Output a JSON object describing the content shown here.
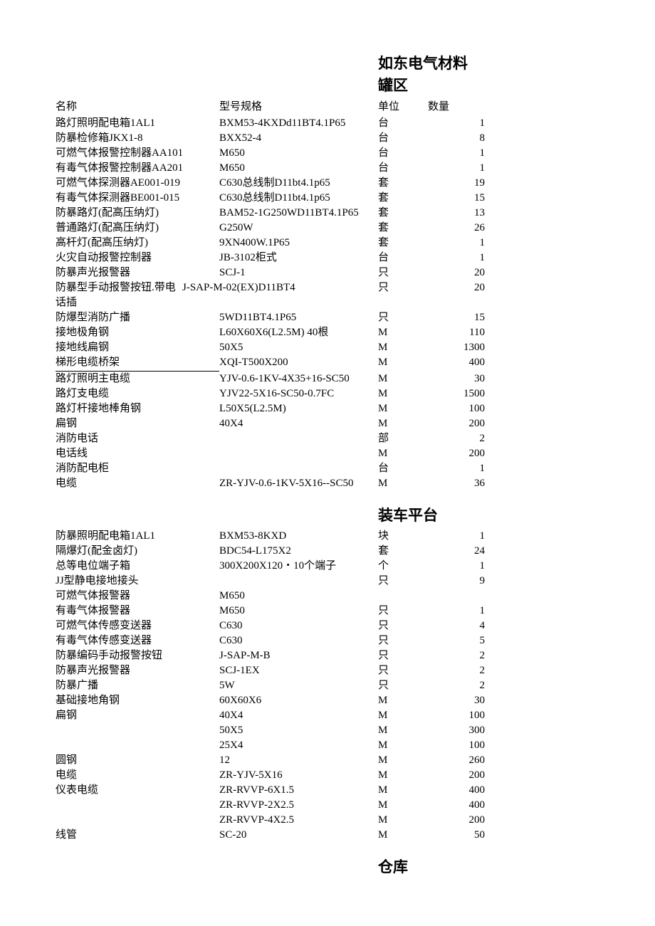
{
  "doc_title": "如东电气材料",
  "section1_title": "罐区",
  "section2_title": "装车平台",
  "section3_title": "仓库",
  "headers": {
    "name": "名称",
    "spec": "型号规格",
    "unit": "单位",
    "qty": "数量"
  },
  "section1_rows": [
    {
      "name": "路灯照明配电箱1AL1",
      "spec": "BXM53-4KXDd11BT4.1P65",
      "unit": "台",
      "qty": "1"
    },
    {
      "name": "防暴检修箱JKX1-8",
      "spec": "BXX52-4",
      "unit": "台",
      "qty": "8"
    },
    {
      "name": "可燃气体报警控制器AA101",
      "spec": "M650",
      "unit": "台",
      "qty": "1"
    },
    {
      "name": "有毒气体报警控制器AA201",
      "spec": "M650",
      "unit": "台",
      "qty": "1"
    },
    {
      "name": "可燃气体探测器AE001-019",
      "spec": "C630总线制D11bt4.1p65",
      "unit": "套",
      "qty": "19"
    },
    {
      "name": "有毒气体探测器BE001-015",
      "spec": "C630总线制D11bt4.1p65",
      "unit": "套",
      "qty": "15"
    },
    {
      "name": "防暴路灯(配高压纳灯)",
      "spec": "BAM52-1G250WD11BT4.1P65",
      "unit": "套",
      "qty": "13"
    },
    {
      "name": "普通路灯(配高压纳灯)",
      "spec": "G250W",
      "unit": "套",
      "qty": "26"
    },
    {
      "name": "高杆灯(配高压纳灯)",
      "spec": "9XN400W.1P65",
      "unit": "套",
      "qty": "1"
    },
    {
      "name": "火灾自动报警控制器",
      "spec": "JB-3102柜式",
      "unit": "台",
      "qty": "1"
    },
    {
      "name": "防暴声光报警器",
      "spec": "SCJ-1",
      "unit": "只",
      "qty": "20"
    },
    {
      "name": "防暴型手动报警按钮.带电话插",
      "spec": "J-SAP-M-02(EX)D11BT4",
      "unit": "只",
      "qty": "20",
      "namewide": true
    },
    {
      "name": "防爆型消防广播",
      "spec": "5WD11BT4.1P65",
      "unit": "只",
      "qty": "15"
    },
    {
      "name": "接地极角钢",
      "spec": "L60X60X6(L2.5M)   40根",
      "unit": "M",
      "qty": "110"
    },
    {
      "name": "接地线扁钢",
      "spec": "50X5",
      "unit": "M",
      "qty": "1300"
    },
    {
      "name": "梯形电缆桥架",
      "spec": "XQI-T500X200",
      "unit": "M",
      "qty": "400",
      "underline": true
    },
    {
      "name": "路灯照明主电缆",
      "spec": "YJV-0.6-1KV-4X35+16-SC50",
      "unit": "M",
      "qty": "30"
    },
    {
      "name": "路灯支电缆",
      "spec": "YJV22-5X16-SC50-0.7FC",
      "unit": "M",
      "qty": "1500"
    },
    {
      "name": "路灯杆接地棒角钢",
      "spec": "L50X5(L2.5M)",
      "unit": "M",
      "qty": "100"
    },
    {
      "name": "扁钢",
      "spec": "40X4",
      "unit": "M",
      "qty": "200"
    },
    {
      "name": "消防电话",
      "spec": "",
      "unit": "部",
      "qty": "2"
    },
    {
      "name": "电话线",
      "spec": "",
      "unit": "M",
      "qty": "200"
    },
    {
      "name": "消防配电柜",
      "spec": "",
      "unit": "台",
      "qty": "1"
    },
    {
      "name": "电缆",
      "spec": "ZR-YJV-0.6-1KV-5X16--SC50",
      "unit": "M",
      "qty": "36"
    }
  ],
  "section2_rows": [
    {
      "name": "防暴照明配电箱1AL1",
      "spec": "BXM53-8KXD",
      "unit": "块",
      "qty": "1"
    },
    {
      "name": "隔爆灯(配金卤灯)",
      "spec": "BDC54-L175X2",
      "unit": "套",
      "qty": "24"
    },
    {
      "name": "总等电位端子箱",
      "spec": "300X200X120・10个端子",
      "unit": "个",
      "qty": "1"
    },
    {
      "name": "JJ型静电接地接头",
      "spec": "",
      "unit": "只",
      "qty": "9"
    },
    {
      "name": "可燃气体报警器",
      "spec": "M650",
      "unit": "",
      "qty": ""
    },
    {
      "name": "有毒气体报警器",
      "spec": "M650",
      "unit": "只",
      "qty": "1"
    },
    {
      "name": "可燃气体传感变送器",
      "spec": " C630",
      "unit": "只",
      "qty": "4"
    },
    {
      "name": "有毒气体传感变送器",
      "spec": "C630",
      "unit": "只",
      "qty": "5"
    },
    {
      "name": "防暴编码手动报警按钮",
      "spec": "J-SAP-M-B",
      "unit": "只",
      "qty": "2"
    },
    {
      "name": "防暴声光报警器",
      "spec": "SCJ-1EX",
      "unit": "只",
      "qty": "2"
    },
    {
      "name": "防暴广播",
      "spec": "5W",
      "unit": "只",
      "qty": "2"
    },
    {
      "name": "基础接地角钢",
      "spec": "60X60X6",
      "unit": "M",
      "qty": "30"
    },
    {
      "name": "扁钢",
      "spec": "40X4",
      "unit": "M",
      "qty": "100"
    },
    {
      "name": "",
      "spec": "50X5",
      "unit": "M",
      "qty": "300"
    },
    {
      "name": "",
      "spec": "25X4",
      "unit": "M",
      "qty": "100"
    },
    {
      "name": "圆钢",
      "spec": "     12",
      "unit": "M",
      "qty": "260"
    },
    {
      "name": "电缆",
      "spec": "ZR-YJV-5X16",
      "unit": "M",
      "qty": "200"
    },
    {
      "name": "仪表电缆",
      "spec": "ZR-RVVP-6X1.5",
      "unit": "M",
      "qty": "400"
    },
    {
      "name": "",
      "spec": "ZR-RVVP-2X2.5",
      "unit": "M",
      "qty": "400"
    },
    {
      "name": "",
      "spec": "ZR-RVVP-4X2.5",
      "unit": "M",
      "qty": "200"
    },
    {
      "name": "线管",
      "spec": "SC-20",
      "unit": "M",
      "qty": "50"
    }
  ]
}
